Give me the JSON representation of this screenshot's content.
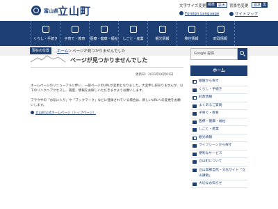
{
  "header": {
    "pref_name": "富山県",
    "town_name": "立山町",
    "font_size_label": "文字サイズ変更",
    "font_size_std": "標準",
    "font_size_large": "拡大",
    "color_label": "背景色変更",
    "color_std": "標準",
    "color_black": "黒",
    "foreign_lang": "Foreign Language",
    "sitemap": "サイトマップ"
  },
  "nav": {
    "items": [
      {
        "label": "くらし・手続き",
        "icon": "home-icon"
      },
      {
        "label": "子育て・教育",
        "icon": "child-icon"
      },
      {
        "label": "医療・健康・福祉",
        "icon": "health-icon"
      },
      {
        "label": "しごと・産業",
        "icon": "work-icon"
      },
      {
        "label": "観光情報",
        "icon": "sightseeing-icon"
      },
      {
        "label": "移住情報",
        "icon": "relocation-icon"
      },
      {
        "label": "町政情報",
        "icon": "government-icon"
      }
    ]
  },
  "breadcrumb": {
    "here_label": "現在の位置",
    "home": "ホーム",
    "sep": "＞",
    "current": "ページが見つかりませんでした"
  },
  "main": {
    "title": "ページが見つかりませんでした",
    "updated": "更新日：2021年06月01日",
    "paragraph1": "ホームページのリニューアルに伴い、一部ページのURLが変更となりました。大変申し訳ありませんが、以下のリンクへアクセスし、再度、情報をお探しいただきますようお願いします。",
    "paragraph2": "ブラウザの「お気に入り」や「ブックマーク」などに登録されている場合は、新しいURLへの変更をお願いします。",
    "link": "立山町公式ホームページ（トップページ）"
  },
  "sidebar": {
    "search_placeholder": "Google 提供",
    "home_header": "ホーム",
    "items": [
      "組織から探す",
      "くらし・手続き",
      "町政情報",
      "よくあるご質問",
      "子育て・教育",
      "医療・健康・福祉",
      "しごと・産業",
      "観光情報",
      "ライフシーンから探す",
      "便利なサービス",
      "立山町について",
      "立山黒部自然・文化サイト「立山讃歌」",
      "大切なお知らせ"
    ]
  },
  "colors": {
    "brand": "#1d3f73"
  }
}
